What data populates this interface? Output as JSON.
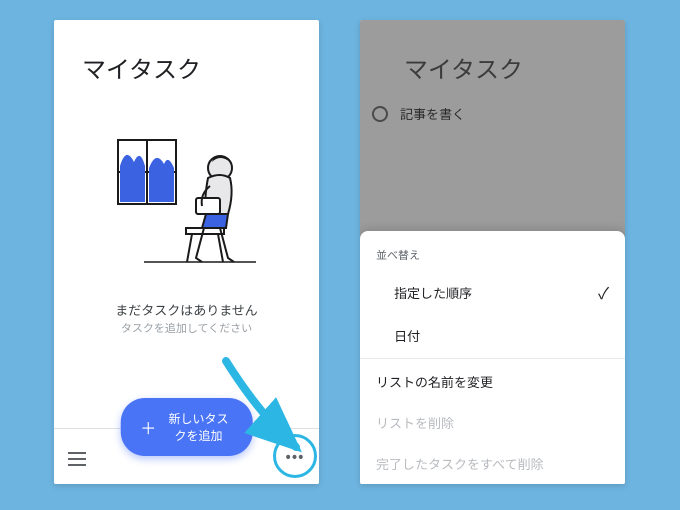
{
  "left": {
    "title": "マイタスク",
    "empty_heading": "まだタスクはありません",
    "empty_sub": "タスクを追加してください",
    "fab_label": "新しいタスクを追加"
  },
  "right": {
    "title": "マイタスク",
    "task1": "記事を書く",
    "sheet": {
      "sort_label": "並べ替え",
      "sort_custom": "指定した順序",
      "sort_date": "日付",
      "rename": "リストの名前を変更",
      "delete_list": "リストを削除",
      "delete_completed": "完了したタスクをすべて削除"
    }
  }
}
